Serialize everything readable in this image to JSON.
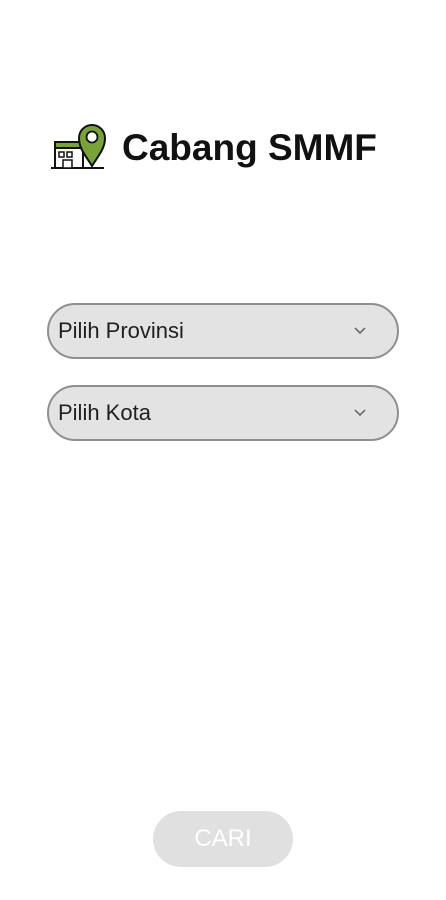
{
  "header": {
    "logo_icon": "branch-location-pin-icon",
    "title": "Cabang SMMF"
  },
  "form": {
    "province_select": {
      "selected_label": "Pilih Provinsi",
      "icon": "chevron-down-icon"
    },
    "city_select": {
      "selected_label": "Pilih Kota",
      "icon": "chevron-down-icon"
    }
  },
  "actions": {
    "search_button_label": "CARI"
  },
  "colors": {
    "pin_green": "#7aa23a",
    "select_fill": "#e3e3e3",
    "select_border": "#8f8f8f",
    "button_disabled": "#e0e0e0",
    "title_text": "#111111"
  }
}
